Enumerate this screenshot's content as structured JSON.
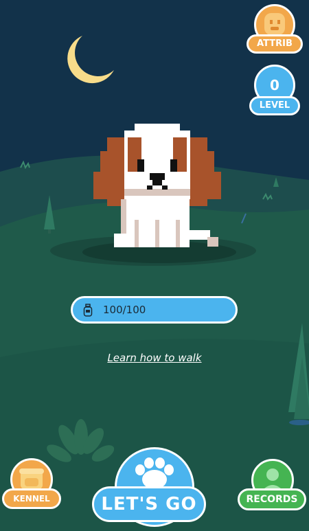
{
  "top_buttons": {
    "attrib_label": "ATTRIB",
    "level_value": "0",
    "level_label": "LEVEL"
  },
  "stamina": {
    "icon": "bottle-icon",
    "value_text": "100/100",
    "fraction": 1.0
  },
  "links": {
    "learn_walk": "Learn how to walk"
  },
  "bottom_buttons": {
    "kennel_label": "KENNEL",
    "go_label": "LET'S GO",
    "records_label": "RECORDS"
  },
  "colors": {
    "sky": "#12324a",
    "hill": "#1f5a4a",
    "orange": "#f2a74a",
    "blue": "#4bb4ee",
    "green": "#45b452",
    "moon": "#f7dc8a"
  }
}
